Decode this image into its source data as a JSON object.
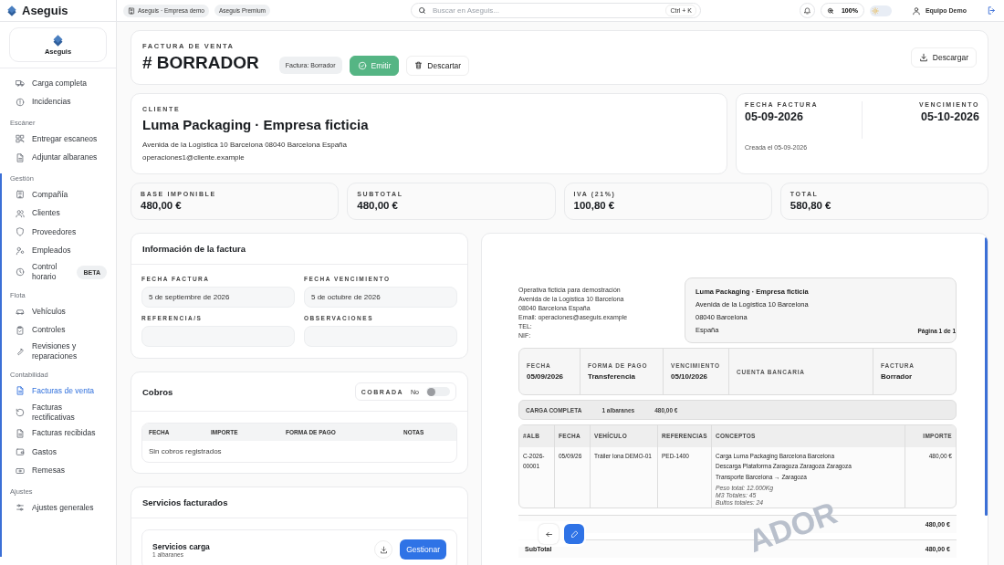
{
  "topbar": {
    "brand": "Aseguis",
    "company_chip": "Aseguis · Empresa demo",
    "plan_chip": "Aseguis Premium",
    "search": {
      "placeholder": "Buscar en Aseguis...",
      "shortcut": "Ctrl + K"
    },
    "zoom": "100%",
    "theme_toggle": {
      "on": false
    },
    "user": "Equipo Demo"
  },
  "sidebar": {
    "logo": "Aseguis",
    "sections": [
      {
        "items": [
          {
            "label": "Carga completa",
            "selected": false
          },
          {
            "label": "Incidencias",
            "selected": false
          }
        ]
      },
      {
        "heading": "Escáner",
        "items": [
          {
            "label": "Entregar escaneos",
            "selected": false
          },
          {
            "label": "Adjuntar albaranes",
            "selected": false
          }
        ]
      },
      {
        "heading": "Gestión",
        "items": [
          {
            "label": "Compañía",
            "selected": false
          },
          {
            "label": "Clientes",
            "selected": false
          },
          {
            "label": "Proveedores",
            "selected": false
          },
          {
            "label": "Empleados",
            "selected": false
          },
          {
            "label": "Control horario",
            "selected": false,
            "badge": "BETA"
          }
        ]
      },
      {
        "heading": "Flota",
        "items": [
          {
            "label": "Vehículos",
            "selected": false
          },
          {
            "label": "Controles",
            "selected": false
          },
          {
            "label": "Revisiones y reparaciones",
            "selected": false
          }
        ]
      },
      {
        "heading": "Contabilidad",
        "items": [
          {
            "label": "Facturas de venta",
            "selected": true
          },
          {
            "label": "Facturas rectificativas",
            "selected": false
          },
          {
            "label": "Facturas recibidas",
            "selected": false
          },
          {
            "label": "Gastos",
            "selected": false
          },
          {
            "label": "Remesas",
            "selected": false
          }
        ]
      },
      {
        "heading": "Ajustes",
        "items": [
          {
            "label": "Ajustes generales",
            "selected": false
          }
        ]
      }
    ]
  },
  "header": {
    "kicker": "FACTURA DE VENTA",
    "title": "# BORRADOR",
    "status_badge": "Factura: Borrador",
    "buttons": [
      {
        "kind": "primary",
        "label": "Emitir"
      },
      {
        "kind": "ghost",
        "label": "Descartar"
      }
    ],
    "download": "Descargar"
  },
  "client": {
    "label": "CLIENTE",
    "name": "Luma Packaging · Empresa ficticia",
    "address": "Avenida de la Logística 10 Barcelona 08040 Barcelona España",
    "email": "operaciones1@cliente.example"
  },
  "dates": {
    "invoice_label": "FECHA FACTURA",
    "invoice_date": "05-09-2026",
    "due_label": "VENCIMIENTO",
    "due_date": "05-10-2026",
    "created": "Creada el 05-09-2026"
  },
  "totals": [
    {
      "label": "BASE IMPONIBLE",
      "value": "480,00 €"
    },
    {
      "label": "SUBTOTAL",
      "value": "480,00 €"
    },
    {
      "label": "IVA (21%)",
      "value": "100,80 €"
    },
    {
      "label": "TOTAL",
      "value": "580,80 €"
    }
  ],
  "info": {
    "title": "Información de la factura",
    "fields": [
      {
        "label": "FECHA FACTURA",
        "value": "5 de septiembre de 2026"
      },
      {
        "label": "FECHA VENCIMIENTO",
        "value": "5 de octubre de 2026"
      },
      {
        "label": "REFERENCIA/S"
      },
      {
        "label": "OBSERVACIONES"
      }
    ]
  },
  "cobros": {
    "title": "Cobros",
    "toggle": {
      "label": "COBRADA",
      "value": "No",
      "on": false
    },
    "columns": [
      "FECHA",
      "IMPORTE",
      "FORMA DE PAGO",
      "NOTAS"
    ],
    "empty": "Sin cobros registrados"
  },
  "servicios": {
    "title": "Servicios facturados",
    "items": [
      {
        "name": "Servicios carga",
        "count": "1 albaranes",
        "action": "Gestionar"
      }
    ]
  },
  "preview": {
    "sender": [
      "Operativa ficticia para demostración",
      "Avenida de la Logística 10 Barcelona",
      "08040 Barcelona España",
      "Email: operaciones@aseguis.example",
      "TEL:",
      "NIF:"
    ],
    "recipient": {
      "name": "Luma Packaging · Empresa ficticia",
      "lines": [
        "Avenida de la Logística 10 Barcelona",
        "08040 Barcelona",
        "España"
      ]
    },
    "page": "Página 1 de 1",
    "meta": [
      {
        "label": "FECHA",
        "value": "05/09/2026"
      },
      {
        "label": "FORMA DE PAGO",
        "value": "Transferencia"
      },
      {
        "label": "VENCIMIENTO",
        "value": "05/10/2026"
      },
      {
        "label": "CUENTA BANCARIA"
      },
      {
        "label": "FACTURA",
        "value": "Borrador"
      }
    ],
    "summary": [
      "CARGA COMPLETA",
      "1 albaranes",
      "480,00 €"
    ],
    "columns": [
      "#ALB",
      "FECHA",
      "VEHÍCULO",
      "REFERENCIAS",
      "CONCEPTOS",
      "IMPORTE"
    ],
    "rows": [
      {
        "alb": "C-2026-00001",
        "date": "05/09/26",
        "vehicle": "Tráiler lona DEMO-01",
        "refs": "PED-1400",
        "concepts": [
          "Carga Luma Packaging Barcelona Barcelona",
          "Descarga Plataforma Zaragoza Zaragoza Zaragoza",
          "Transporte Barcelona → Zaragoza"
        ],
        "notes": [
          "Peso total: 12.000Kg",
          "M3 Totales: 45",
          "Bultos totales: 24"
        ],
        "amount": "480,00 €"
      }
    ],
    "sums": [
      {
        "value": "480,00 €"
      },
      {
        "label": "SubTotal",
        "value": "480,00 €"
      }
    ],
    "watermark": "ADOR"
  }
}
